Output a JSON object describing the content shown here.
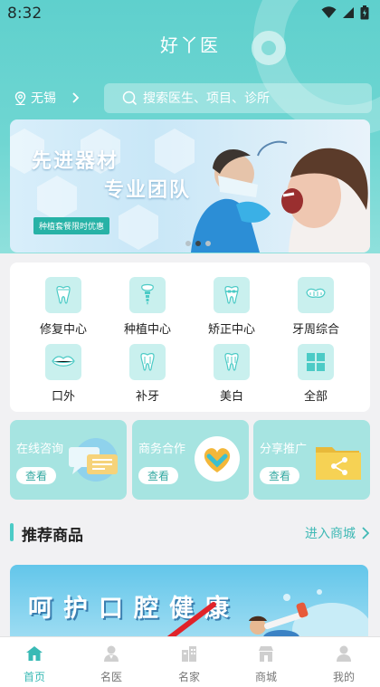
{
  "status": {
    "time": "8:32"
  },
  "app": {
    "title": "好丫医"
  },
  "header": {
    "city": "无锡",
    "search_placeholder": "搜索医生、项目、诊所"
  },
  "banner": {
    "line1": "先进器材",
    "line2": "专业团队",
    "tag": "种植套餐限时优惠"
  },
  "categories": [
    {
      "label": "修复中心",
      "icon": "tooth-crown-icon"
    },
    {
      "label": "种植中心",
      "icon": "implant-icon"
    },
    {
      "label": "矫正中心",
      "icon": "braces-icon"
    },
    {
      "label": "牙周综合",
      "icon": "gum-icon"
    },
    {
      "label": "口外",
      "icon": "lips-icon"
    },
    {
      "label": "补牙",
      "icon": "tooth-filling-icon"
    },
    {
      "label": "美白",
      "icon": "whitening-icon"
    },
    {
      "label": "全部",
      "icon": "grid-icon"
    }
  ],
  "services": [
    {
      "title": "在线咨询",
      "button": "查看",
      "icon": "chat-bubbles-icon"
    },
    {
      "title": "商务合作",
      "button": "查看",
      "icon": "handshake-heart-icon"
    },
    {
      "title": "分享推广",
      "button": "查看",
      "icon": "share-folder-icon"
    }
  ],
  "recommend": {
    "title": "推荐商品",
    "link": "进入商城"
  },
  "promo": {
    "text": "呵护口腔健康"
  },
  "tabs": [
    {
      "label": "首页",
      "icon": "home-icon",
      "active": true
    },
    {
      "label": "名医",
      "icon": "doctor-icon",
      "active": false
    },
    {
      "label": "名家",
      "icon": "building-icon",
      "active": false
    },
    {
      "label": "商城",
      "icon": "store-icon",
      "active": false
    },
    {
      "label": "我的",
      "icon": "user-icon",
      "active": false
    }
  ],
  "colors": {
    "accent": "#4ccbc6",
    "active_tab": "#39bab5",
    "annotation_arrow": "#e0232a"
  }
}
